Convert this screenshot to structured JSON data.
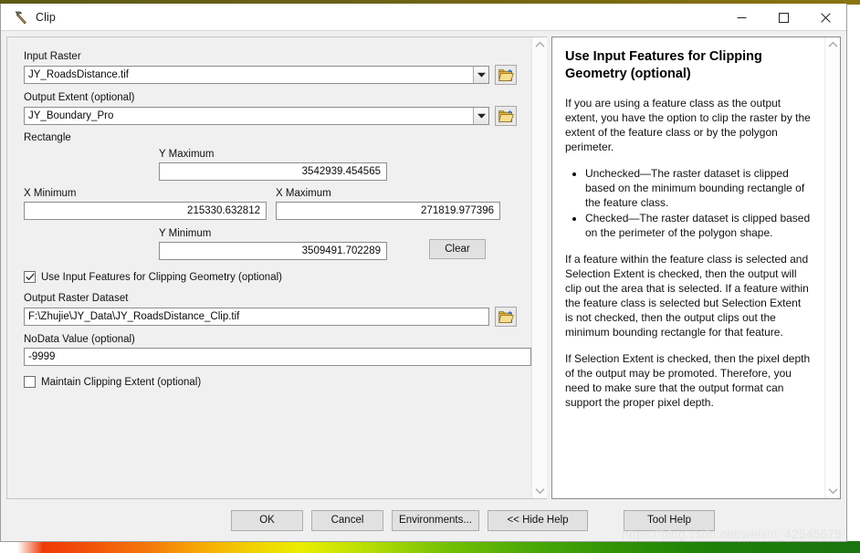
{
  "window": {
    "title": "Clip",
    "icon": "hammer-icon",
    "minimize_label": "Minimize",
    "maximize_label": "Maximize",
    "close_label": "Close"
  },
  "form": {
    "input_raster": {
      "label": "Input Raster",
      "value": "JY_RoadsDistance.tif",
      "browse_label": "Browse"
    },
    "output_extent": {
      "label": "Output Extent (optional)",
      "value": "JY_Boundary_Pro",
      "browse_label": "Browse"
    },
    "rectangle": {
      "label": "Rectangle",
      "y_maximum": {
        "label": "Y Maximum",
        "value": "3542939.454565"
      },
      "x_minimum": {
        "label": "X Minimum",
        "value": "215330.632812"
      },
      "x_maximum": {
        "label": "X Maximum",
        "value": "271819.977396"
      },
      "y_minimum": {
        "label": "Y Minimum",
        "value": "3509491.702289"
      },
      "clear_label": "Clear"
    },
    "use_input_features": {
      "label": "Use Input Features for Clipping Geometry (optional)",
      "checked": true
    },
    "output_raster_dataset": {
      "label": "Output Raster Dataset",
      "value": "F:\\Zhujie\\JY_Data\\JY_RoadsDistance_Clip.tif",
      "browse_label": "Browse"
    },
    "nodata_value": {
      "label": "NoData Value (optional)",
      "value": "-9999"
    },
    "maintain_clipping_extent": {
      "label": "Maintain Clipping Extent (optional)",
      "checked": false
    }
  },
  "help": {
    "heading": "Use Input Features for Clipping Geometry (optional)",
    "paragraph_1": "If you are using a feature class as the output extent, you have the option to clip the raster by the extent of the feature class or by the polygon perimeter.",
    "bullets": [
      "Unchecked—The raster dataset is clipped based on the minimum bounding rectangle of the feature class.",
      "Checked—The raster dataset is clipped based on the perimeter of the polygon shape."
    ],
    "paragraph_2": "If a feature within the feature class is selected and Selection Extent is checked, then the output will clip out the area that is selected. If a feature within the feature class is selected but Selection Extent is not checked, then the output clips out the minimum bounding rectangle for that feature.",
    "paragraph_3": "If Selection Extent is checked, then the pixel depth of the output may be promoted. Therefore, you need to make sure that the output format can support the proper pixel depth."
  },
  "footer": {
    "ok": "OK",
    "cancel": "Cancel",
    "environments": "Environments...",
    "hide_help": "<< Hide Help",
    "tool_help": "Tool Help"
  },
  "watermark": "https://blog.csdn.net/weixin_42545675",
  "colors": {
    "dialog_bg": "#f0f0f0",
    "field_bg": "#ffffff",
    "field_border": "#8d8d8d",
    "button_bg": "#e1e1e1",
    "folder_icon": "#f5c84a",
    "accent_close": "#e81123"
  }
}
